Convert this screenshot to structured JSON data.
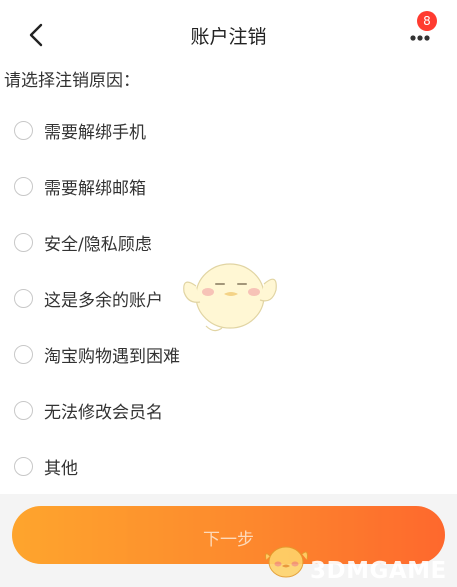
{
  "header": {
    "title": "账户注销",
    "badge_count": "8",
    "icons": {
      "back": "chevron-left-icon",
      "more": "more-dots-icon"
    }
  },
  "prompt": "请选择注销原因：",
  "reasons": [
    "需要解绑手机",
    "需要解绑邮箱",
    "安全/隐私顾虑",
    "这是多余的账户",
    "淘宝购物遇到困难",
    "无法修改会员名",
    "其他"
  ],
  "next_button": {
    "label": "下一步"
  },
  "watermark": {
    "text": "3DMGAME"
  },
  "colors": {
    "button_start": "#ff9a12",
    "button_end": "#ff5512",
    "badge": "#ff3b30",
    "footer_bg": "#f4f4f4"
  }
}
